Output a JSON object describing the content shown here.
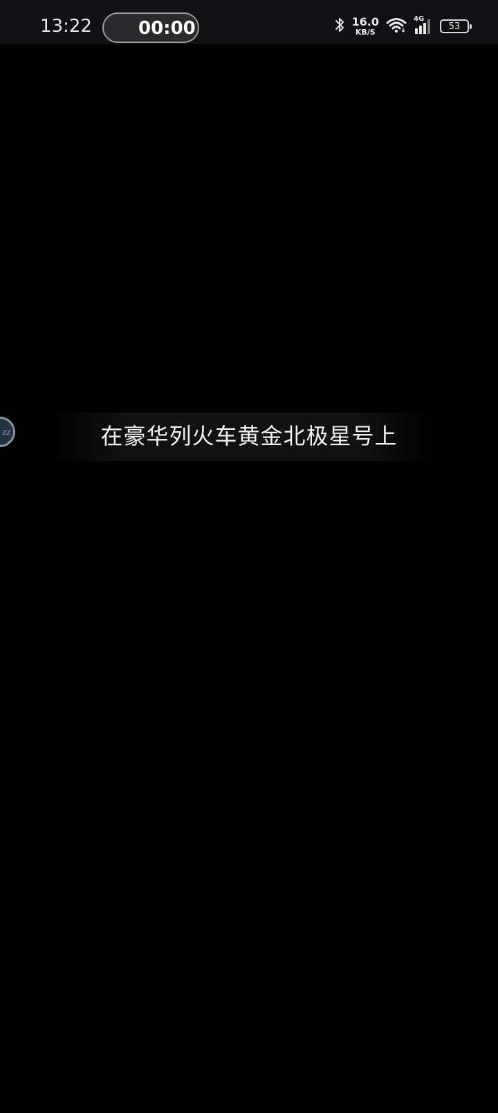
{
  "status_bar": {
    "time": "13:22",
    "timer": "00:00",
    "net_speed": "16.0",
    "net_speed_unit": "KB/S",
    "network_type": "4G",
    "battery_level": "53",
    "icons": [
      "bluetooth-icon",
      "wifi-icon",
      "cellular-signal-icon",
      "battery-icon"
    ]
  },
  "floating_ball": {
    "glyph": "zz"
  },
  "player": {
    "subtitle": "在豪华列火车黄金北极星号上"
  },
  "colors": {
    "background": "#000000",
    "status_bar": "#111114",
    "text": "#ffffff"
  }
}
